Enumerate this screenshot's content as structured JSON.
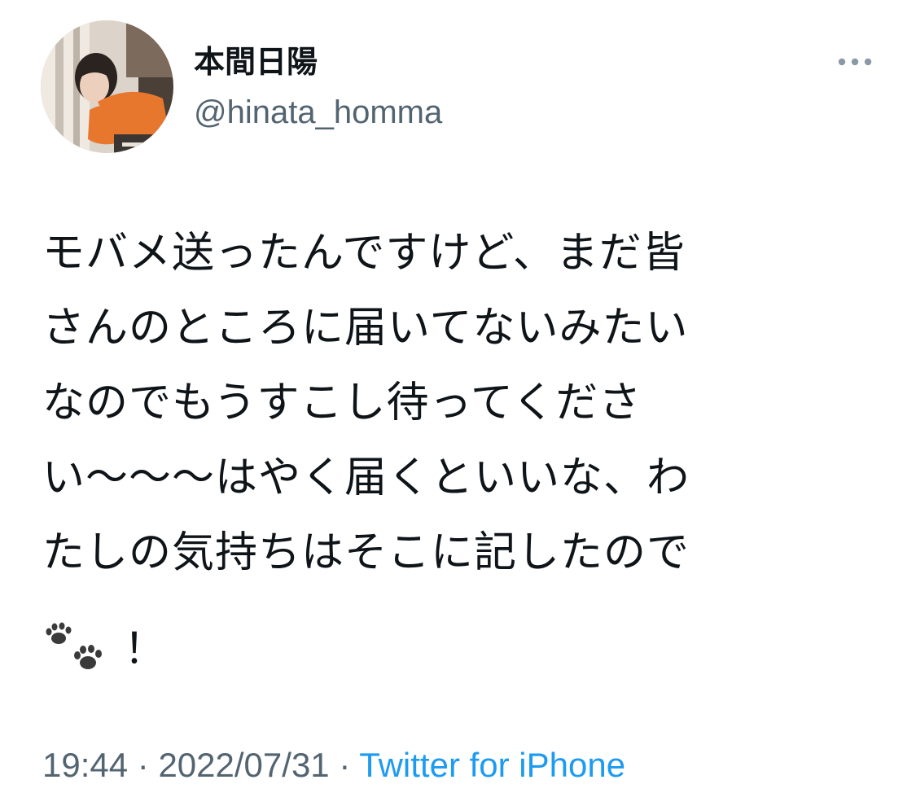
{
  "author": {
    "display_name": "本間日陽",
    "handle": "@hinata_homma",
    "avatar_icon": "profile-photo"
  },
  "tweet": {
    "text": "モバメ送ったんですけど、まだ皆\nさんのところに届いてないみたい\nなのでもうすこし待ってくださ\nい〜〜〜はやく届くといいな、わ\nたしの気持ちはそこに記したので",
    "emoji": "paw-prints-icon",
    "text_tail": "！"
  },
  "meta": {
    "time": "19:44",
    "separator": "·",
    "date": "2022/07/31",
    "source": "Twitter for iPhone"
  },
  "icons": {
    "more": "more-horizontal-icon"
  },
  "colors": {
    "text": "#0f1419",
    "secondary": "#536471",
    "link": "#1d9bf0"
  }
}
